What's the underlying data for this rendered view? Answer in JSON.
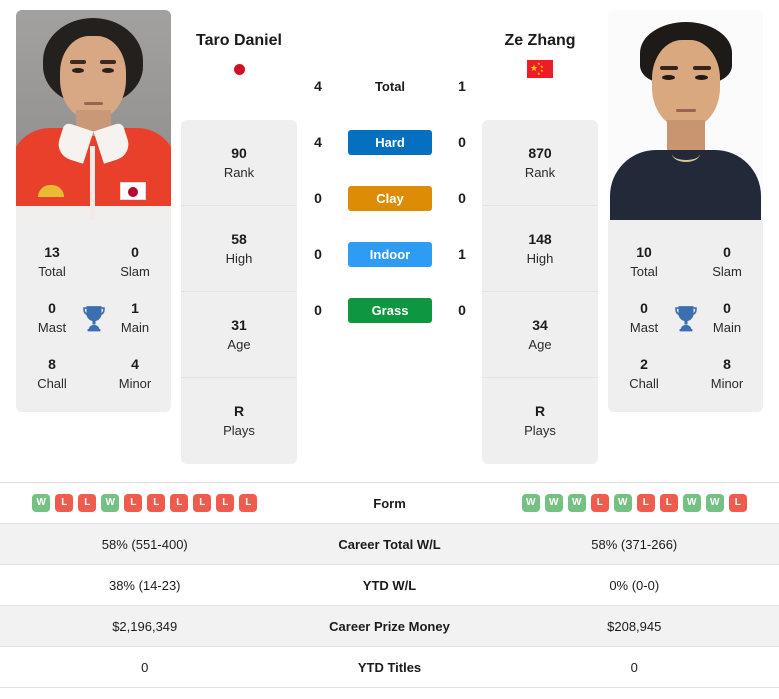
{
  "players": {
    "left": {
      "name": "Taro Daniel",
      "photo_caption": "Taro Daniel",
      "country_flag": "japan-flag",
      "stats": [
        {
          "value": "90",
          "label": "Rank"
        },
        {
          "value": "58",
          "label": "High"
        },
        {
          "value": "31",
          "label": "Age"
        },
        {
          "value": "R",
          "label": "Plays"
        }
      ],
      "titles": [
        {
          "value": "13",
          "label": "Total"
        },
        {
          "value": "0",
          "label": "Slam"
        },
        {
          "value": "0",
          "label": "Mast"
        },
        {
          "value": "1",
          "label": "Main"
        },
        {
          "value": "8",
          "label": "Chall"
        },
        {
          "value": "4",
          "label": "Minor"
        }
      ],
      "form": [
        "W",
        "L",
        "L",
        "W",
        "L",
        "L",
        "L",
        "L",
        "L",
        "L"
      ],
      "career_total_wl": "58% (551-400)",
      "ytd_wl": "38% (14-23)",
      "career_prize_money": "$2,196,349",
      "ytd_titles": "0"
    },
    "right": {
      "name": "Ze Zhang",
      "photo_caption": "Ze Zhang",
      "country_flag": "china-flag",
      "stats": [
        {
          "value": "870",
          "label": "Rank"
        },
        {
          "value": "148",
          "label": "High"
        },
        {
          "value": "34",
          "label": "Age"
        },
        {
          "value": "R",
          "label": "Plays"
        }
      ],
      "titles": [
        {
          "value": "10",
          "label": "Total"
        },
        {
          "value": "0",
          "label": "Slam"
        },
        {
          "value": "0",
          "label": "Mast"
        },
        {
          "value": "0",
          "label": "Main"
        },
        {
          "value": "2",
          "label": "Chall"
        },
        {
          "value": "8",
          "label": "Minor"
        }
      ],
      "form": [
        "W",
        "W",
        "W",
        "L",
        "W",
        "L",
        "L",
        "W",
        "W",
        "L"
      ],
      "career_total_wl": "58% (371-266)",
      "ytd_wl": "0% (0-0)",
      "career_prize_money": "$208,945",
      "ytd_titles": "0"
    }
  },
  "head_to_head": [
    {
      "label": "Total",
      "left": "4",
      "right": "1",
      "color": ""
    },
    {
      "label": "Hard",
      "left": "4",
      "right": "0",
      "color": "#0670c0"
    },
    {
      "label": "Clay",
      "left": "0",
      "right": "0",
      "color": "#dd8c06"
    },
    {
      "label": "Indoor",
      "left": "0",
      "right": "1",
      "color": "#2f9cf4"
    },
    {
      "label": "Grass",
      "left": "0",
      "right": "0",
      "color": "#0e9641"
    }
  ],
  "table_rows": [
    {
      "label": "Form"
    },
    {
      "label": "Career Total W/L"
    },
    {
      "label": "YTD W/L"
    },
    {
      "label": "Career Prize Money"
    },
    {
      "label": "YTD Titles"
    }
  ],
  "colors": {
    "win": "#74c183",
    "loss": "#ef5b4c",
    "trophy": "#3c6fb0",
    "panel": "#efefef",
    "stripe": "#f2f2f2"
  }
}
